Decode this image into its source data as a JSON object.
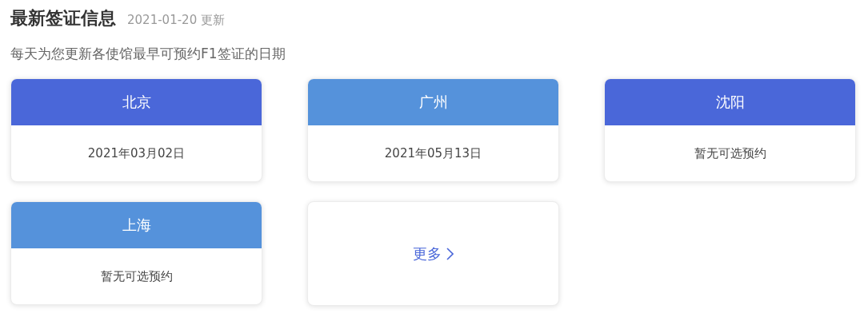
{
  "title": "最新签证信息",
  "updated": "2021-01-20 更新",
  "subtitle": "每天为您更新各使馆最早可预约F1签证的日期",
  "cities": [
    {
      "name": "北京",
      "color": "#4a67d9",
      "date": "2021年03月02日"
    },
    {
      "name": "广州",
      "color": "#5592db",
      "date": "2021年05月13日"
    },
    {
      "name": "沈阳",
      "color": "#4a67d9",
      "date": "暂无可选预约"
    },
    {
      "name": "上海",
      "color": "#5592db",
      "date": "暂无可选预约"
    }
  ],
  "more": "更多"
}
